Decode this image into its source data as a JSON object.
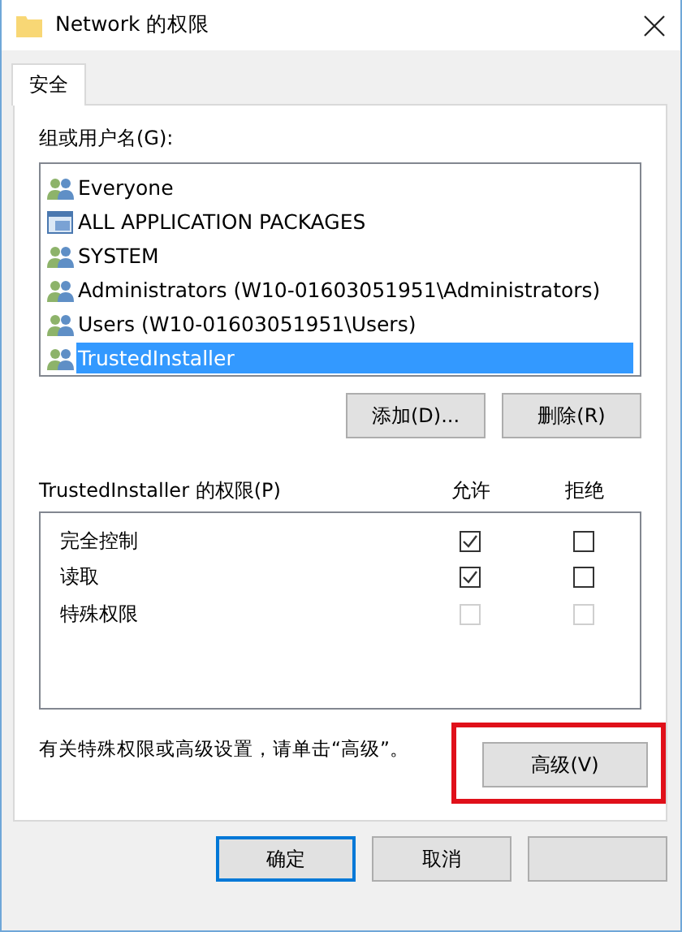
{
  "window": {
    "title": "Network 的权限"
  },
  "tabs": [
    {
      "label": "安全",
      "selected": true
    }
  ],
  "groups": {
    "label": "组或用户名(G):",
    "items": [
      {
        "name": "Everyone",
        "kind": "group",
        "selected": false
      },
      {
        "name": "ALL APPLICATION PACKAGES",
        "kind": "package",
        "selected": false
      },
      {
        "name": "SYSTEM",
        "kind": "group",
        "selected": false
      },
      {
        "name": "Administrators (W10-01603051951\\Administrators)",
        "kind": "group",
        "selected": false
      },
      {
        "name": "Users (W10-01603051951\\Users)",
        "kind": "group",
        "selected": false
      },
      {
        "name": "TrustedInstaller",
        "kind": "group",
        "selected": true
      }
    ],
    "buttons": [
      "添加(D)...",
      "删除(R)"
    ]
  },
  "permissions": {
    "label": "TrustedInstaller 的权限(P)",
    "columns": [
      "允许",
      "拒绝"
    ],
    "rows": [
      {
        "name": "完全控制",
        "allow": {
          "checked": true,
          "disabled": false
        },
        "deny": {
          "checked": false,
          "disabled": false
        }
      },
      {
        "name": "读取",
        "allow": {
          "checked": true,
          "disabled": false
        },
        "deny": {
          "checked": false,
          "disabled": false
        }
      },
      {
        "name": "特殊权限",
        "allow": {
          "checked": false,
          "disabled": true
        },
        "deny": {
          "checked": false,
          "disabled": true
        }
      }
    ]
  },
  "advanced": {
    "hint": "有关特殊权限或高级设置，请单击“高级”。",
    "button": "高级(V)",
    "highlighted": true
  },
  "footer_buttons": [
    {
      "label": "确定",
      "default": true
    },
    {
      "label": "取消",
      "default": false
    },
    {
      "default": false
    }
  ]
}
